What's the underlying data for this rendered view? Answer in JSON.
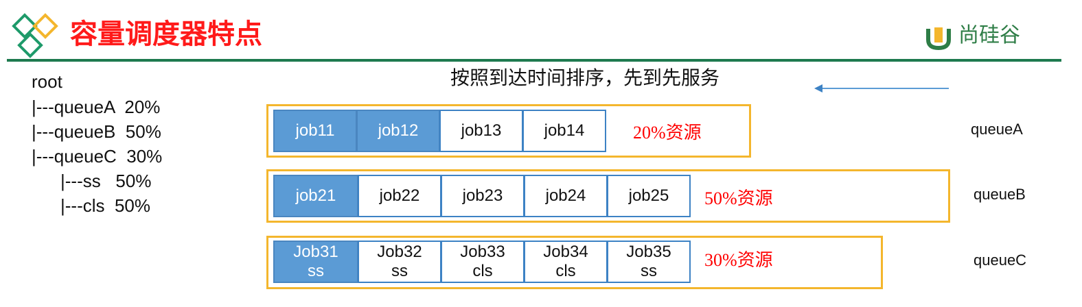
{
  "header": {
    "title": "容量调度器特点",
    "brand": "尚硅谷",
    "rule_color": "#1e7a4f"
  },
  "tree": [
    "root",
    "|---queueA  20%",
    "|---queueB  50%",
    "|---queueC  30%",
    "|---ss   50%",
    "|---cls  50%"
  ],
  "subtitle": "按照到达时间排序，先到先服务",
  "queues": [
    {
      "label": "queueA",
      "resource": "20%资源",
      "jobs": [
        {
          "name": "job11",
          "sub": "",
          "state": "running"
        },
        {
          "name": "job12",
          "sub": "",
          "state": "running"
        },
        {
          "name": "job13",
          "sub": "",
          "state": "waiting"
        },
        {
          "name": "job14",
          "sub": "",
          "state": "waiting"
        }
      ]
    },
    {
      "label": "queueB",
      "resource": "50%资源",
      "jobs": [
        {
          "name": "job21",
          "sub": "",
          "state": "running"
        },
        {
          "name": "job22",
          "sub": "",
          "state": "waiting"
        },
        {
          "name": "job23",
          "sub": "",
          "state": "waiting"
        },
        {
          "name": "job24",
          "sub": "",
          "state": "waiting"
        },
        {
          "name": "job25",
          "sub": "",
          "state": "waiting"
        }
      ]
    },
    {
      "label": "queueC",
      "resource": "30%资源",
      "jobs": [
        {
          "name": "Job31",
          "sub": "ss",
          "state": "running"
        },
        {
          "name": "Job32",
          "sub": "ss",
          "state": "waiting"
        },
        {
          "name": "Job33",
          "sub": "cls",
          "state": "waiting"
        },
        {
          "name": "Job34",
          "sub": "cls",
          "state": "waiting"
        },
        {
          "name": "Job35",
          "sub": "ss",
          "state": "waiting"
        }
      ]
    }
  ],
  "colors": {
    "title": "#ff1a1a",
    "frame": "#f4b62d",
    "running_job": "#5b9bd5",
    "job_border": "#3d82c4",
    "resource_text": "#ff0000",
    "arrow": "#5b9bd5",
    "brand": "#2e7d46"
  },
  "icons": [
    "diamond-logo-icon",
    "brand-logo-icon",
    "left-arrow-icon"
  ]
}
